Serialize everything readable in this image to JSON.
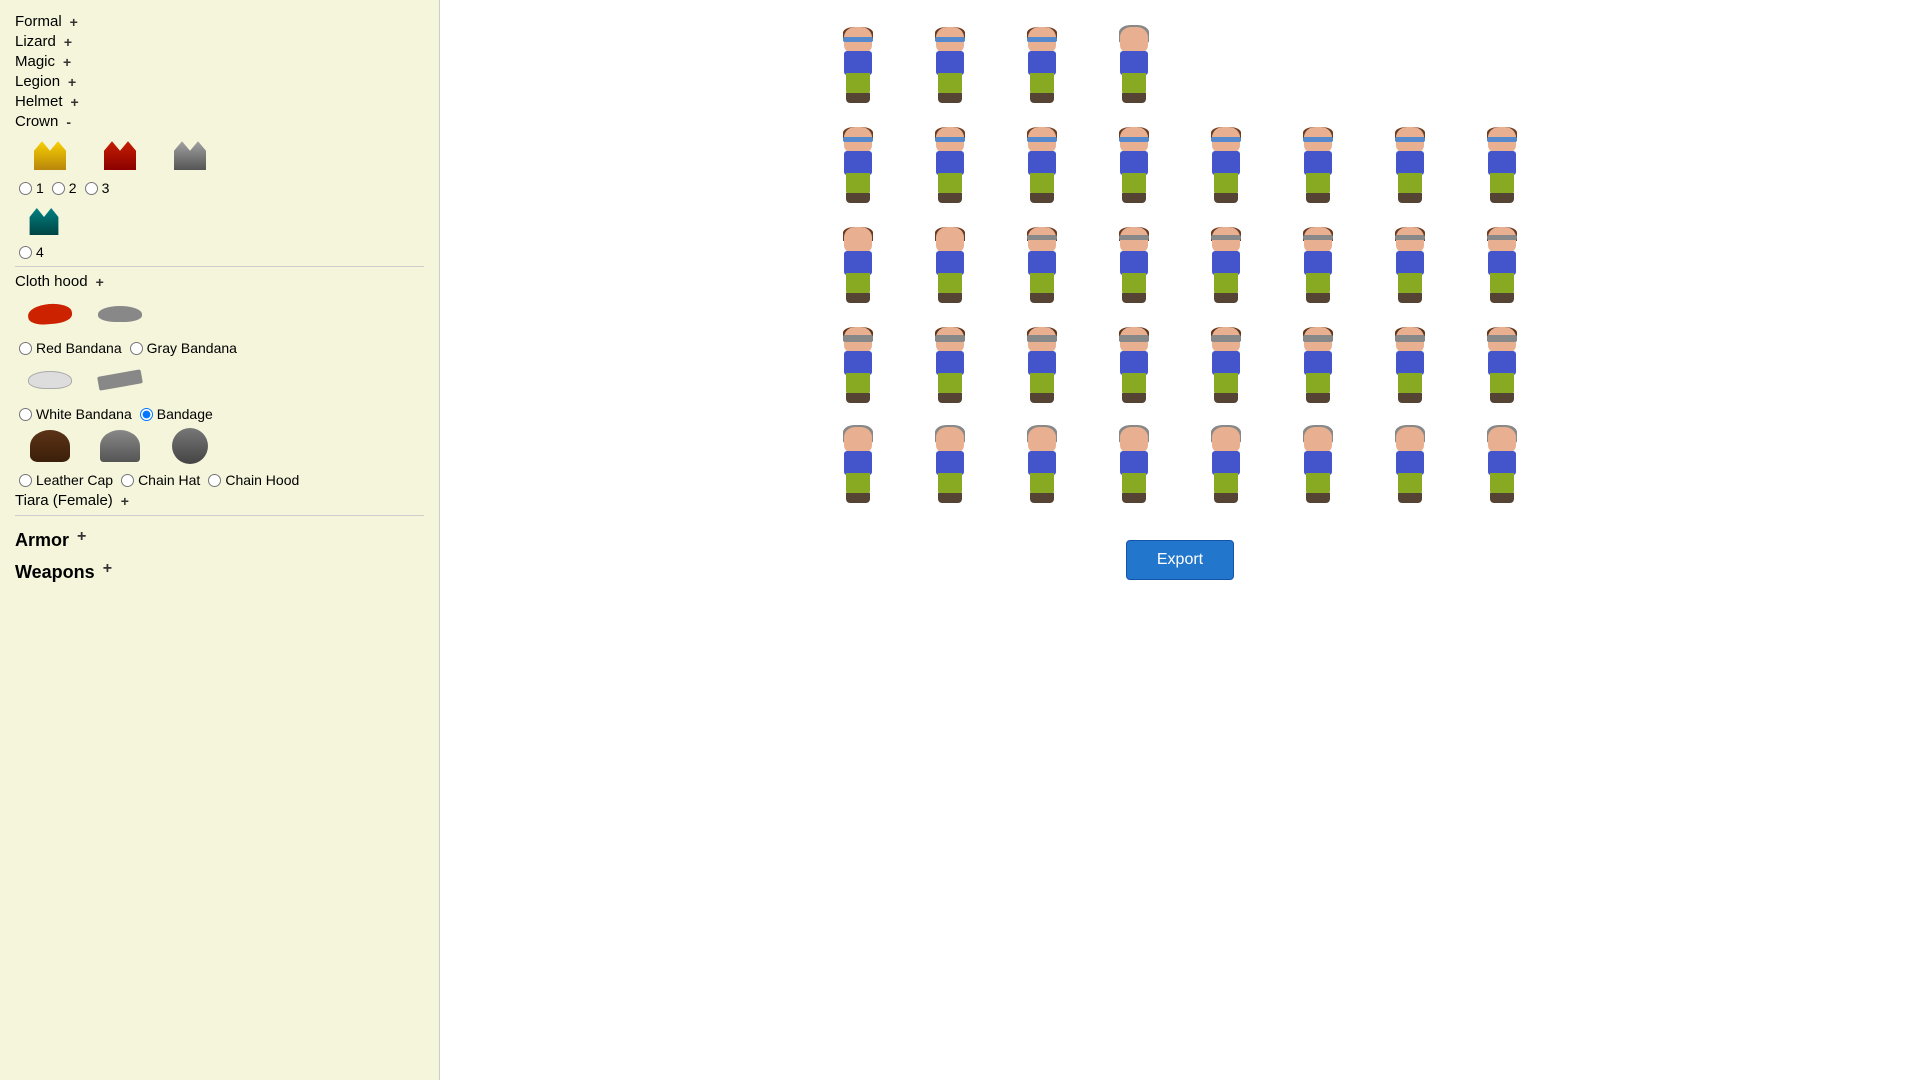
{
  "sidebar": {
    "categories": [
      {
        "label": "Formal",
        "action": "plus"
      },
      {
        "label": "Lizard",
        "action": "plus"
      },
      {
        "label": "Magic",
        "action": "plus"
      },
      {
        "label": "Legion",
        "action": "plus"
      },
      {
        "label": "Helmet",
        "action": "plus"
      },
      {
        "label": "Crown",
        "action": "minus"
      }
    ],
    "crown_options": [
      {
        "id": "1",
        "value": "1"
      },
      {
        "id": "2",
        "value": "2"
      },
      {
        "id": "3",
        "value": "3"
      },
      {
        "id": "4",
        "value": "4"
      }
    ],
    "cloth_hood_label": "Cloth hood",
    "cloth_hood_action": "plus",
    "bandana_options": [
      {
        "label": "Red Bandana",
        "checked": false
      },
      {
        "label": "Gray Bandana",
        "checked": false
      },
      {
        "label": "White Bandana",
        "checked": false
      },
      {
        "label": "Bandage",
        "checked": true
      }
    ],
    "leather_options": [
      {
        "label": "Leather Cap",
        "checked": false
      },
      {
        "label": "Chain Hat",
        "checked": false
      },
      {
        "label": "Chain Hood",
        "checked": false
      }
    ],
    "tiara_label": "Tiara (Female)",
    "tiara_action": "plus",
    "armor_label": "Armor",
    "armor_action": "plus",
    "weapons_label": "Weapons",
    "weapons_action": "plus"
  },
  "main": {
    "export_label": "Export",
    "sprite_rows": [
      {
        "count": 4
      },
      {
        "count": 8
      },
      {
        "count": 8
      },
      {
        "count": 8
      },
      {
        "count": 8
      }
    ]
  }
}
